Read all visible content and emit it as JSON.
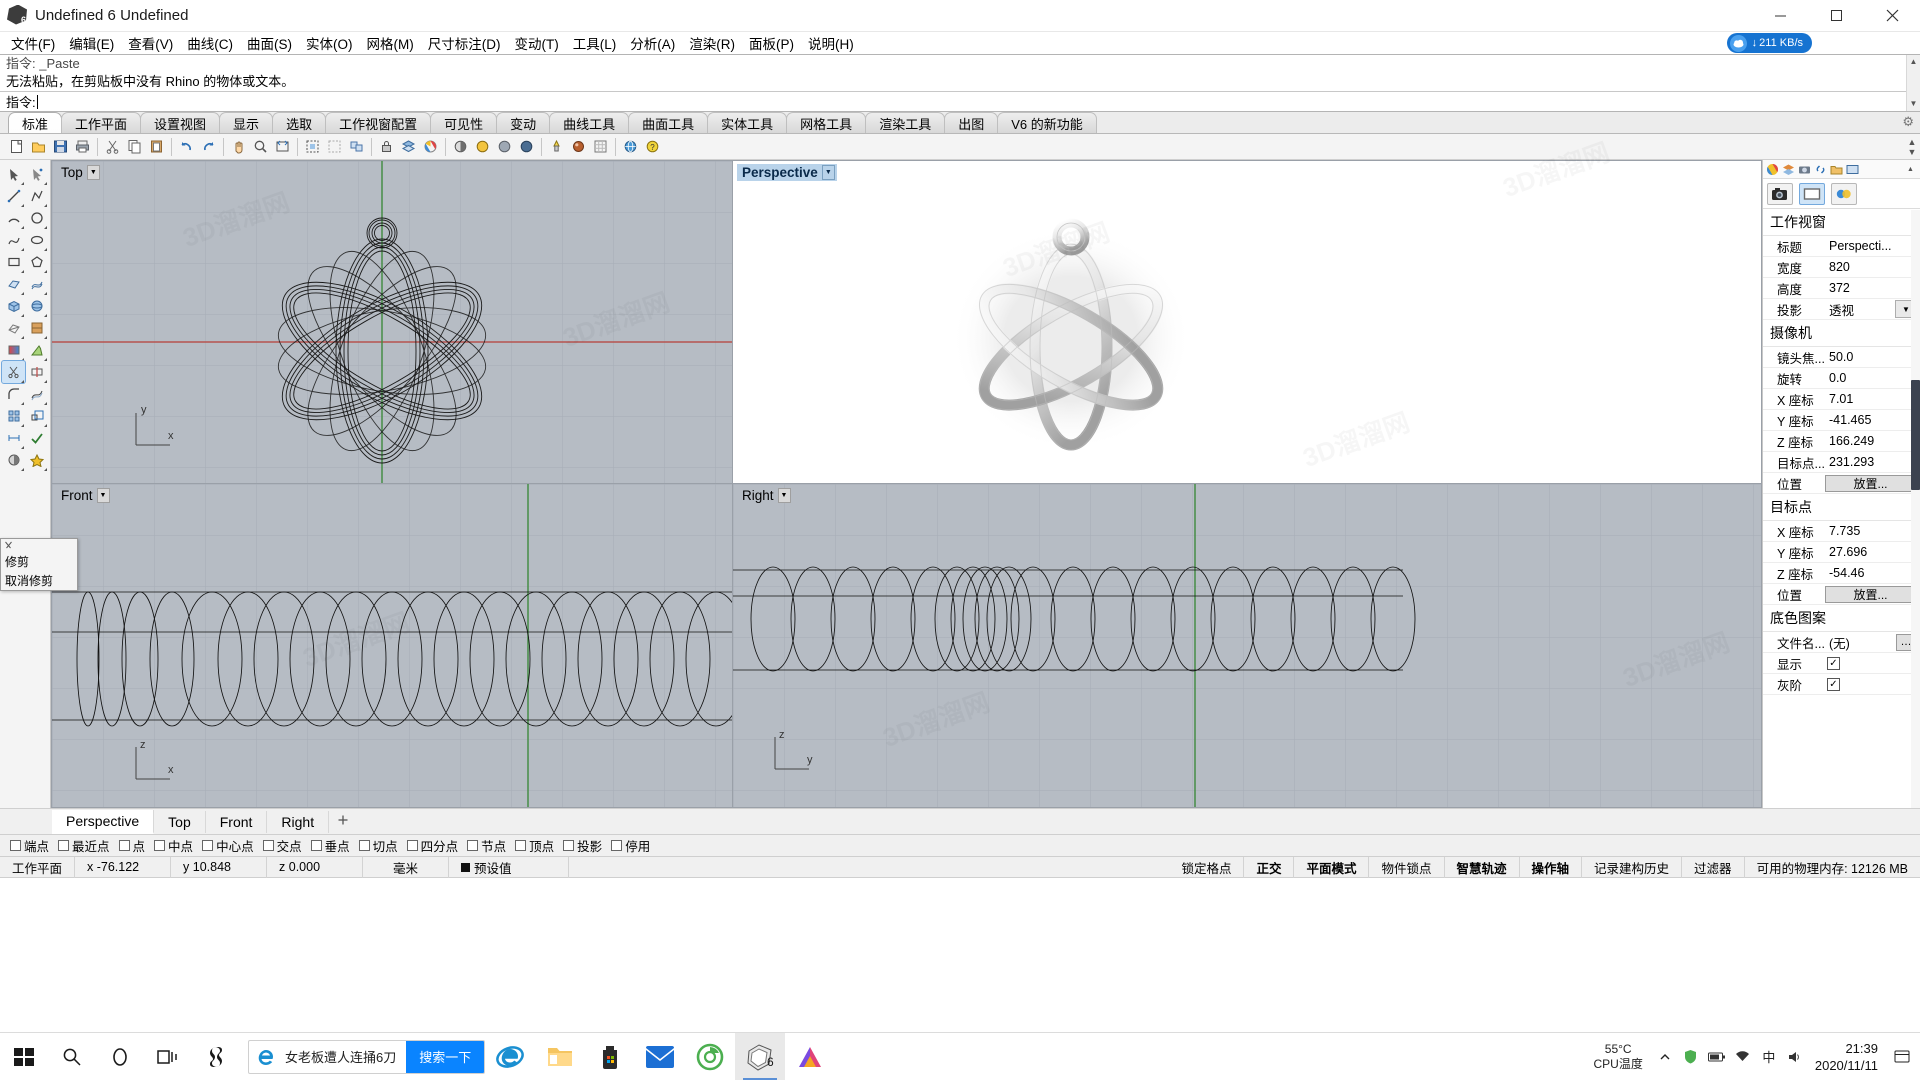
{
  "window": {
    "title": "Undefined 6 Undefined",
    "app_icon": "rhino-logo-icon",
    "minimize": "─",
    "maximize": "☐",
    "close": "✕"
  },
  "menubar": {
    "items": [
      {
        "label": "文件(F)",
        "name": "menu-file"
      },
      {
        "label": "编辑(E)",
        "name": "menu-edit"
      },
      {
        "label": "查看(V)",
        "name": "menu-view"
      },
      {
        "label": "曲线(C)",
        "name": "menu-curve"
      },
      {
        "label": "曲面(S)",
        "name": "menu-surface"
      },
      {
        "label": "实体(O)",
        "name": "menu-solid"
      },
      {
        "label": "网格(M)",
        "name": "menu-mesh"
      },
      {
        "label": "尺寸标注(D)",
        "name": "menu-dimension"
      },
      {
        "label": "变动(T)",
        "name": "menu-transform"
      },
      {
        "label": "工具(L)",
        "name": "menu-tools"
      },
      {
        "label": "分析(A)",
        "name": "menu-analyze"
      },
      {
        "label": "渲染(R)",
        "name": "menu-render"
      },
      {
        "label": "面板(P)",
        "name": "menu-panels"
      },
      {
        "label": "说明(H)",
        "name": "menu-help"
      }
    ],
    "network_badge": {
      "speed": "211 KB/s",
      "arrow": "↓"
    }
  },
  "command": {
    "history_line_1": "指令: _Paste",
    "history_line_2": "无法粘贴，在剪贴板中没有 Rhino 的物体或文本。",
    "prompt_label": "指令:",
    "prompt_value": ""
  },
  "toolbar_tabs": {
    "items": [
      {
        "label": "标准",
        "active": true
      },
      {
        "label": "工作平面",
        "active": false
      },
      {
        "label": "设置视图",
        "active": false
      },
      {
        "label": "显示",
        "active": false
      },
      {
        "label": "选取",
        "active": false
      },
      {
        "label": "工作视窗配置",
        "active": false
      },
      {
        "label": "可见性",
        "active": false
      },
      {
        "label": "变动",
        "active": false
      },
      {
        "label": "曲线工具",
        "active": false
      },
      {
        "label": "曲面工具",
        "active": false
      },
      {
        "label": "实体工具",
        "active": false
      },
      {
        "label": "网格工具",
        "active": false
      },
      {
        "label": "渲染工具",
        "active": false
      },
      {
        "label": "出图",
        "active": false
      },
      {
        "label": "V6 的新功能",
        "active": false
      }
    ],
    "settings_icon": "gear-icon"
  },
  "sidebar_tooltip": {
    "header_icon": "trim-icon",
    "rows": [
      "修剪",
      "取消修剪"
    ]
  },
  "viewports": [
    {
      "name": "top",
      "title": "Top",
      "active": false,
      "axis_labels": [
        "y",
        "x"
      ]
    },
    {
      "name": "perspective",
      "title": "Perspective",
      "active": true,
      "axis_labels": []
    },
    {
      "name": "front",
      "title": "Front",
      "active": false,
      "axis_labels": [
        "z",
        "x"
      ]
    },
    {
      "name": "right",
      "title": "Right",
      "active": false,
      "axis_labels": [
        "z",
        "y"
      ]
    }
  ],
  "viewport_tabs": {
    "items": [
      {
        "label": "Perspective",
        "active": true
      },
      {
        "label": "Top",
        "active": false
      },
      {
        "label": "Front",
        "active": false
      },
      {
        "label": "Right",
        "active": false
      }
    ],
    "add_label": "+"
  },
  "osnap": {
    "items": [
      {
        "label": "端点",
        "checked": false
      },
      {
        "label": "最近点",
        "checked": false
      },
      {
        "label": "点",
        "checked": false
      },
      {
        "label": "中点",
        "checked": false
      },
      {
        "label": "中心点",
        "checked": false
      },
      {
        "label": "交点",
        "checked": false
      },
      {
        "label": "垂点",
        "checked": false
      },
      {
        "label": "切点",
        "checked": false
      },
      {
        "label": "四分点",
        "checked": false
      },
      {
        "label": "节点",
        "checked": false
      },
      {
        "label": "顶点",
        "checked": false
      },
      {
        "label": "投影",
        "checked": false
      },
      {
        "label": "停用",
        "checked": false
      }
    ]
  },
  "statusbar": {
    "cplane_label": "工作平面",
    "x": "x -76.122",
    "y": "y 10.848",
    "z": "z 0.000",
    "unit": "毫米",
    "layer": "预设值",
    "layer_color": "#111111",
    "toggles": [
      {
        "label": "锁定格点",
        "bold": false
      },
      {
        "label": "正交",
        "bold": true
      },
      {
        "label": "平面模式",
        "bold": true
      },
      {
        "label": "物件锁点",
        "bold": false
      },
      {
        "label": "智慧轨迹",
        "bold": true
      },
      {
        "label": "操作轴",
        "bold": true
      },
      {
        "label": "记录建构历史",
        "bold": false
      },
      {
        "label": "过滤器",
        "bold": false
      }
    ],
    "memory": "可用的物理内存: 12126 MB"
  },
  "properties_panel": {
    "tab_icons": [
      "color-wheel-icon",
      "layers-icon",
      "camera-icon",
      "link-icon",
      "folder-icon",
      "display-icon"
    ],
    "tool_icons": [
      "camera-icon",
      "viewport-icon",
      "material-icon"
    ],
    "sections": [
      {
        "title": "工作视窗",
        "rows": [
          {
            "label": "标题",
            "value": "Perspecti...",
            "type": "text"
          },
          {
            "label": "宽度",
            "value": "820",
            "type": "text"
          },
          {
            "label": "高度",
            "value": "372",
            "type": "text"
          },
          {
            "label": "投影",
            "value": "透视",
            "type": "combo"
          }
        ]
      },
      {
        "title": "摄像机",
        "rows": [
          {
            "label": "镜头焦...",
            "value": "50.0",
            "type": "text"
          },
          {
            "label": "旋转",
            "value": "0.0",
            "type": "text"
          },
          {
            "label": "X 座标",
            "value": "7.01",
            "type": "text"
          },
          {
            "label": "Y 座标",
            "value": "-41.465",
            "type": "text"
          },
          {
            "label": "Z 座标",
            "value": "166.249",
            "type": "text"
          },
          {
            "label": "目标点...",
            "value": "231.293",
            "type": "text"
          },
          {
            "label": "位置",
            "value": "放置...",
            "type": "button"
          }
        ]
      },
      {
        "title": "目标点",
        "rows": [
          {
            "label": "X 座标",
            "value": "7.735",
            "type": "text"
          },
          {
            "label": "Y 座标",
            "value": "27.696",
            "type": "text"
          },
          {
            "label": "Z 座标",
            "value": "-54.46",
            "type": "text"
          },
          {
            "label": "位置",
            "value": "放置...",
            "type": "button"
          }
        ]
      },
      {
        "title": "底色图案",
        "rows": [
          {
            "label": "文件名...",
            "value": "(无)",
            "type": "dots"
          },
          {
            "label": "显示",
            "value": "",
            "type": "check"
          },
          {
            "label": "灰阶",
            "value": "",
            "type": "check"
          }
        ]
      }
    ]
  },
  "taskbar": {
    "start_icon": "windows-start-icon",
    "search_icon": "search-icon",
    "cortana_icon": "cortana-circle-icon",
    "taskview_icon": "task-view-icon",
    "app_icon": "sogou-icon",
    "search_pill": {
      "browser_icon": "ie-icon",
      "text": "女老板遭人连捅6刀",
      "button": "搜索一下"
    },
    "apps": [
      {
        "name": "ie-browser",
        "icon": "ie-icon"
      },
      {
        "name": "file-explorer",
        "icon": "folder-icon"
      },
      {
        "name": "microsoft-store",
        "icon": "store-icon"
      },
      {
        "name": "mail",
        "icon": "mail-icon"
      },
      {
        "name": "360-browser",
        "icon": "green-browser-icon"
      },
      {
        "name": "rhino",
        "icon": "rhino-icon",
        "active": true
      },
      {
        "name": "color-app",
        "icon": "prism-icon"
      }
    ],
    "tray": {
      "temp_line1": "55°C",
      "temp_line2": "CPU温度",
      "chevron": "∧",
      "icons": [
        "shield-icon",
        "battery-icon",
        "network-icon",
        "sound-icon"
      ],
      "ime": "中",
      "time": "21:39",
      "date": "2020/11/11",
      "notification_icon": "notification-icon"
    }
  },
  "watermark": "3D溜溜网"
}
